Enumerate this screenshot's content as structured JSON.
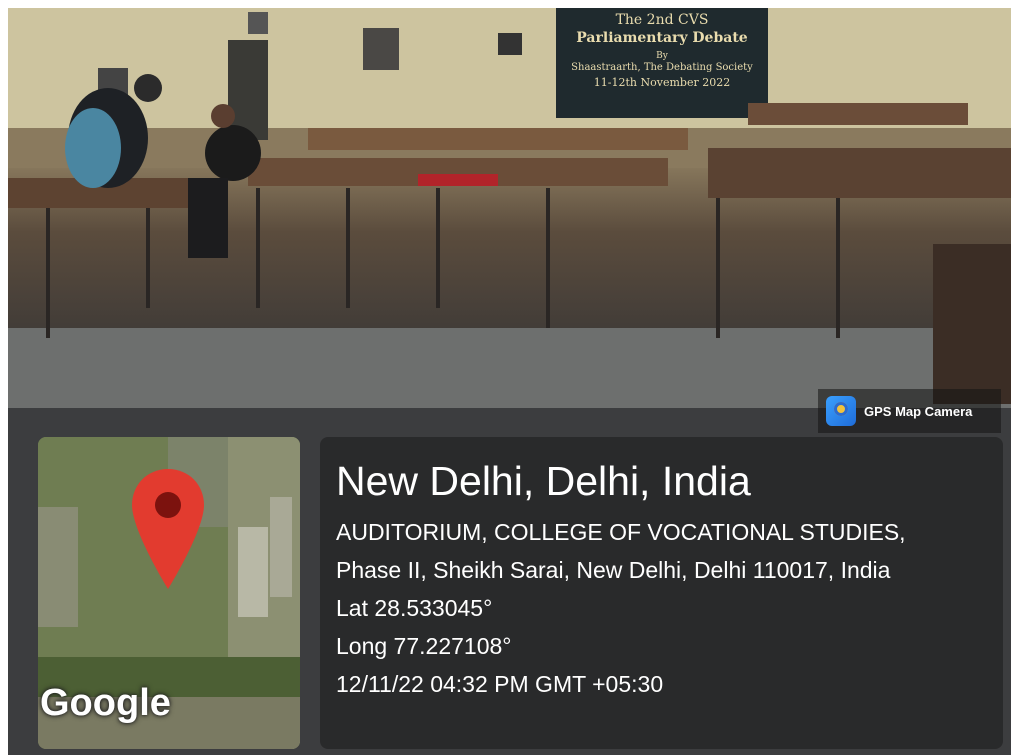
{
  "banner": {
    "line1": "The 2nd CVS",
    "line2": "Parliamentary Debate",
    "line3": "By",
    "line4": "Shaastraarth, The Debating Society",
    "line5": "11-12th November 2022"
  },
  "gps_tag": {
    "app_name": "GPS Map Camera",
    "icon": "gps-map-camera-icon"
  },
  "map": {
    "brand": "Google",
    "pin_icon": "location-pin-icon",
    "pin_color": "#e23b2f"
  },
  "location": {
    "title": "New Delhi, Delhi, India",
    "address_line1": "AUDITORIUM, COLLEGE OF VOCATIONAL STUDIES,",
    "address_line2": "Phase II, Sheikh Sarai, New Delhi, Delhi 110017, India",
    "latitude": "Lat 28.533045°",
    "longitude": "Long 77.227108°",
    "timestamp": "12/11/22 04:32 PM GMT +05:30"
  }
}
